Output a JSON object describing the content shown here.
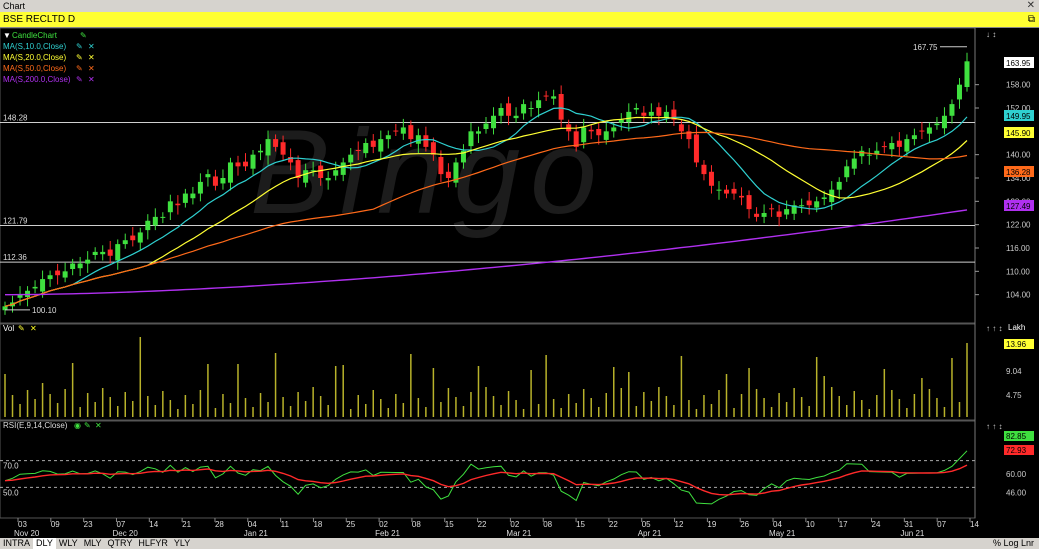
{
  "window": {
    "title": "Chart",
    "close_icon": "close-icon"
  },
  "symbol_bar": {
    "title": "BSE RECLTD D",
    "restore_icon": "restore-icon"
  },
  "price_panel": {
    "legend": [
      {
        "label": "CandleChart",
        "color": "#3fe03f"
      },
      {
        "label": "MA(S,10.0,Close)",
        "color": "#2fd0d0"
      },
      {
        "label": "MA(S,20.0,Close)",
        "color": "#ffff33"
      },
      {
        "label": "MA(S,50.0,Close)",
        "color": "#ff6a1a"
      },
      {
        "label": "MA(S,200.0,Close)",
        "color": "#b030f0"
      }
    ],
    "scale_ticks": [
      "158.00",
      "152.00",
      "140.00",
      "134.00",
      "128.00",
      "122.00",
      "116.00",
      "110.00",
      "104.00"
    ],
    "price_tags": [
      {
        "text": "163.95",
        "bg": "#ffffff",
        "fg": "#000000"
      },
      {
        "text": "149.95",
        "bg": "#2fd0d0",
        "fg": "#000000"
      },
      {
        "text": "145.90",
        "bg": "#ffff33",
        "fg": "#000000"
      },
      {
        "text": "136.28",
        "bg": "#ff6a1a",
        "fg": "#000000"
      },
      {
        "text": "127.49",
        "bg": "#b030f0",
        "fg": "#000000"
      }
    ],
    "hlines": [
      "148.28",
      "121.79",
      "112.36"
    ],
    "high_label": "167.75",
    "low_label": "100.10",
    "watermark": "Bingo"
  },
  "volume_panel": {
    "legend": "Vol",
    "unit": "Lakh",
    "scale_ticks": [
      "9.04",
      "4.75"
    ],
    "tag": "13.96"
  },
  "rsi_panel": {
    "legend": "RSI(E,9,14,Close)",
    "scale_ticks": [
      "60.00",
      "46.00"
    ],
    "levels": [
      "70.0",
      "50.0"
    ],
    "tag_green": "82.85",
    "tag_red": "72.93"
  },
  "x_axis": {
    "day_labels": [
      "03",
      "09",
      "23",
      "07",
      "14",
      "21",
      "28",
      "04",
      "11",
      "18",
      "25",
      "02",
      "08",
      "15",
      "22",
      "02",
      "08",
      "15",
      "22",
      "05",
      "12",
      "19",
      "26",
      "04",
      "10",
      "17",
      "24",
      "31",
      "07",
      "14"
    ],
    "month_labels": [
      "Nov 20",
      "Dec 20",
      "Jan 21",
      "Feb 21",
      "Mar 21",
      "Apr 21",
      "May 21",
      "Jun 21"
    ]
  },
  "tabs": [
    "INTRA",
    "DLY",
    "WLY",
    "MLY",
    "QTRY",
    "HLFYR",
    "YLY"
  ],
  "selected_tab": "DLY",
  "tabs_right": "% Log Lnr",
  "chart_data": {
    "type": "line",
    "title": "BSE RECLTD D",
    "ohlc_close_approx": [
      101,
      102,
      104,
      105,
      106,
      108,
      109,
      109,
      110,
      112,
      112,
      113,
      115,
      115,
      114,
      117,
      118,
      118,
      120,
      123,
      124,
      124,
      128,
      127,
      130,
      130,
      133,
      135,
      132,
      134,
      138,
      137,
      137,
      140,
      141,
      144,
      142,
      140,
      138,
      134,
      136,
      136,
      134,
      134,
      136,
      138,
      140,
      141,
      143,
      142,
      144,
      145,
      146,
      147,
      144,
      145,
      142,
      140,
      135,
      134,
      138,
      141,
      146,
      146,
      148,
      150,
      152,
      150,
      150,
      153,
      152,
      154,
      155,
      155,
      149,
      146,
      142,
      147,
      146,
      145,
      146,
      147,
      149,
      151,
      152,
      150,
      151,
      150,
      151,
      149,
      146,
      144,
      138,
      135,
      132,
      131,
      130,
      130,
      129,
      126,
      124,
      125,
      126,
      124,
      126,
      127,
      127,
      127,
      128,
      129,
      131,
      133,
      137,
      139,
      141,
      140,
      141,
      142,
      143,
      142,
      144,
      145,
      146,
      147,
      148,
      150,
      153,
      158,
      164
    ],
    "ylim": [
      98,
      170
    ]
  }
}
